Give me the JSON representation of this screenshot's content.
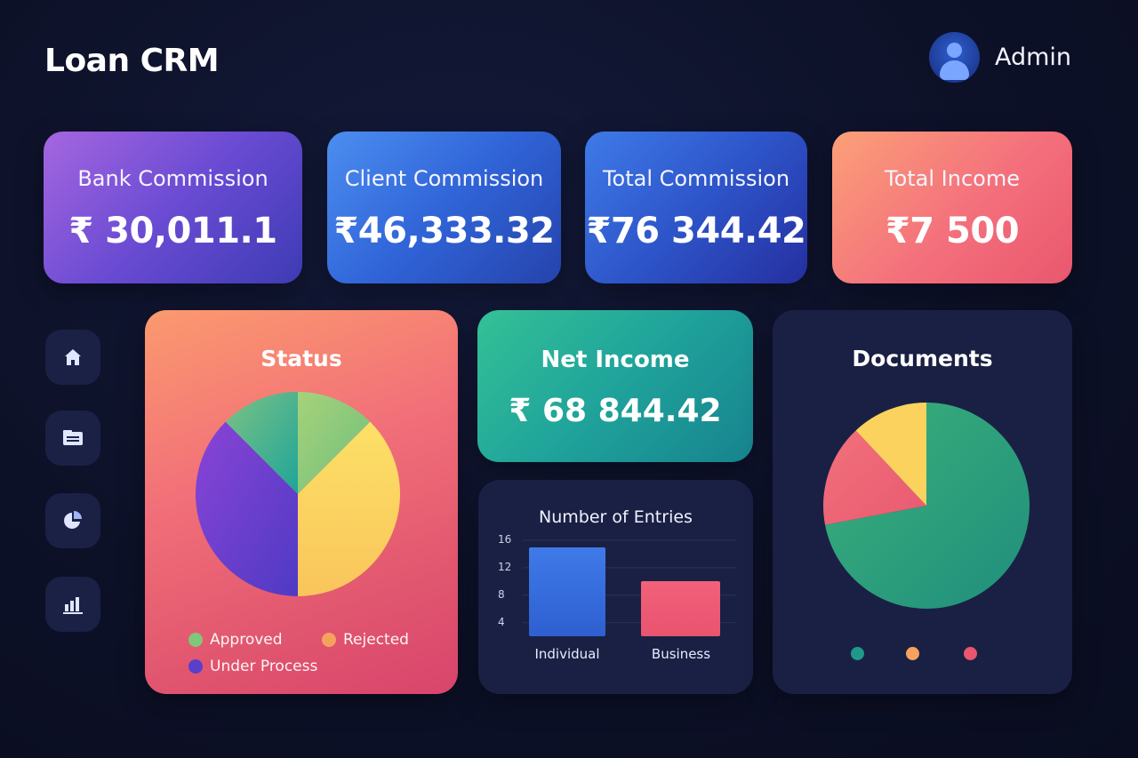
{
  "header": {
    "app_title": "Loan CRM",
    "user_name": "Admin"
  },
  "kpis": {
    "bank_commission": {
      "label": "Bank Commission",
      "value": "₹ 30,011.1"
    },
    "client_commission": {
      "label": "Client Commission",
      "value": "₹46,333.32"
    },
    "total_commission": {
      "label": "Total Commission",
      "value": "₹76 344.42"
    },
    "total_income": {
      "label": "Total Income",
      "value": "₹7 500"
    }
  },
  "sidebar": {
    "items": [
      {
        "icon": "home-icon"
      },
      {
        "icon": "documents-icon"
      },
      {
        "icon": "pie-chart-icon"
      },
      {
        "icon": "bar-chart-icon"
      }
    ]
  },
  "net_income": {
    "label": "Net Income",
    "value": "₹ 68 844.42"
  },
  "status": {
    "title": "Status",
    "legend": [
      {
        "label": "Approved",
        "color": "#7fc77a"
      },
      {
        "label": "Rejected",
        "color": "#f5a25e"
      },
      {
        "label": "Under Process",
        "color": "#5a3fcb"
      }
    ]
  },
  "documents": {
    "title": "Documents",
    "legend_colors": [
      "#1f9a8a",
      "#f5a25e",
      "#e9566f"
    ]
  },
  "colors": {
    "background": "#0d1128",
    "card_dark": "#1a2044",
    "pie_green": "#8cc97a",
    "pie_yellow": "#fcd35f",
    "pie_purple": "#6a3fcf",
    "pie_teal": "#2bab93",
    "doc_green": "#2ea67e",
    "doc_red": "#ef6677",
    "doc_yellow": "#fbd25d",
    "bar_blue": "#3a6fe0",
    "bar_red": "#ef5f78"
  },
  "chart_data": [
    {
      "type": "pie",
      "title": "Status",
      "slices": [
        {
          "label": "Approved",
          "value": 12.5
        },
        {
          "label": "Rejected",
          "value": 37.5
        },
        {
          "label": "Under Process",
          "value": 37.5
        },
        {
          "label": "",
          "value": 12.5
        }
      ]
    },
    {
      "type": "bar",
      "title": "Number of Entries",
      "categories": [
        "Individual",
        "Business"
      ],
      "values": [
        15,
        10
      ],
      "yticks": [
        4,
        8,
        12,
        16
      ],
      "ylim": [
        2,
        16
      ]
    },
    {
      "type": "pie",
      "title": "Documents",
      "slices": [
        {
          "label": "",
          "value": 72
        },
        {
          "label": "",
          "value": 16
        },
        {
          "label": "",
          "value": 12
        }
      ]
    }
  ]
}
